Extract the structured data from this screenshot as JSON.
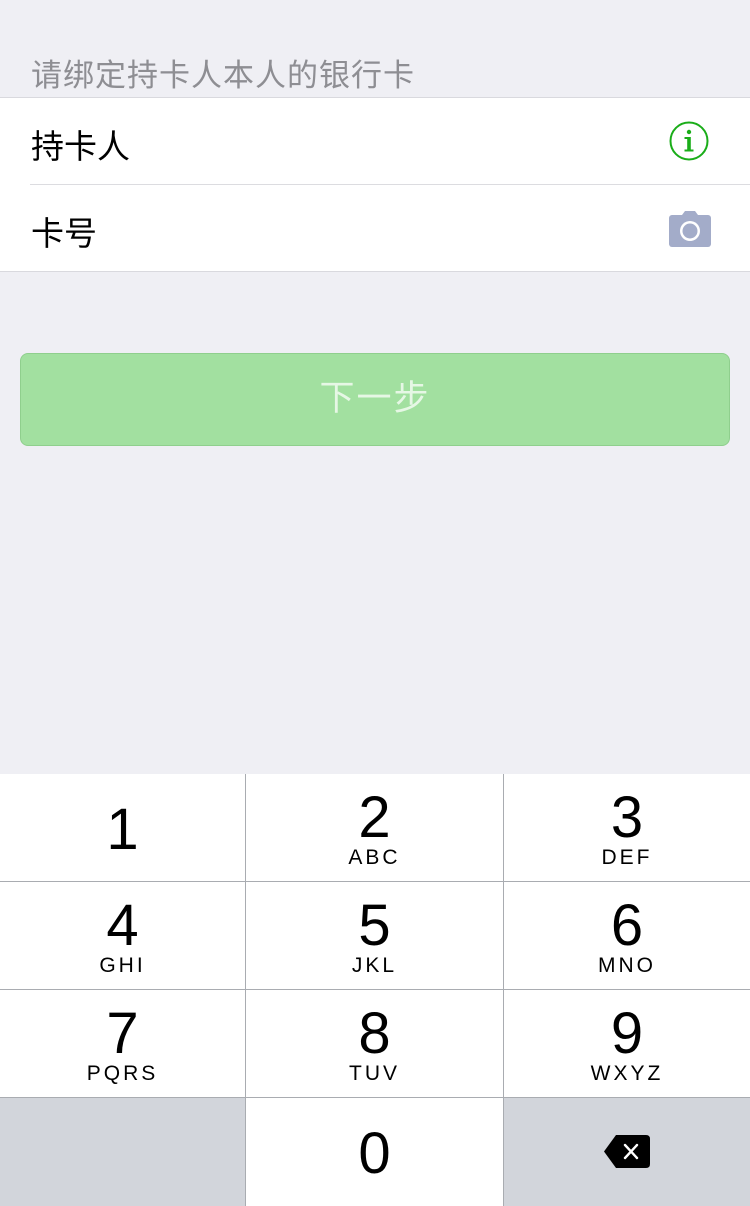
{
  "form": {
    "hint": "请绑定持卡人本人的银行卡",
    "rows": [
      {
        "label": "持卡人",
        "icon": "info-icon",
        "icon_color": "#1aad19"
      },
      {
        "label": "卡号",
        "icon": "camera-icon",
        "icon_color": "#a3acc9"
      }
    ]
  },
  "next_button": {
    "label": "下一步",
    "state": "disabled",
    "color": "#a2e0a0"
  },
  "keypad": {
    "keys": [
      {
        "digit": "1",
        "letters": ""
      },
      {
        "digit": "2",
        "letters": "ABC"
      },
      {
        "digit": "3",
        "letters": "DEF"
      },
      {
        "digit": "4",
        "letters": "GHI"
      },
      {
        "digit": "5",
        "letters": "JKL"
      },
      {
        "digit": "6",
        "letters": "MNO"
      },
      {
        "digit": "7",
        "letters": "PQRS"
      },
      {
        "digit": "8",
        "letters": "TUV"
      },
      {
        "digit": "9",
        "letters": "WXYZ"
      },
      {
        "digit": "0",
        "letters": ""
      }
    ],
    "delete_icon": "backspace-icon"
  }
}
